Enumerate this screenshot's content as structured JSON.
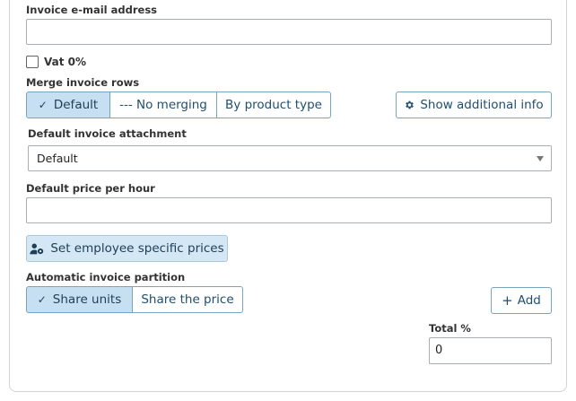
{
  "invoice_email": {
    "label": "Invoice e-mail address",
    "value": ""
  },
  "vat": {
    "label": "Vat 0%",
    "checked": false
  },
  "merge_rows": {
    "label": "Merge invoice rows",
    "options": [
      {
        "label": "Default",
        "active": true
      },
      {
        "label": "--- No merging",
        "active": false
      },
      {
        "label": "By product type",
        "active": false
      }
    ],
    "check_glyph": "✓"
  },
  "show_additional_info": {
    "label": "Show additional info",
    "icon": "gear-icon"
  },
  "attachment": {
    "label": "Default invoice attachment",
    "selected": "Default"
  },
  "price_per_hour": {
    "label": "Default price per hour",
    "value": ""
  },
  "employee_prices": {
    "label": "Set employee specific prices",
    "icon": "user-gear-icon"
  },
  "partition": {
    "label": "Automatic invoice partition",
    "options": [
      {
        "label": "Share units",
        "active": true
      },
      {
        "label": "Share the price",
        "active": false
      }
    ],
    "check_glyph": "✓"
  },
  "add_button": {
    "label": "Add",
    "glyph": "+"
  },
  "total": {
    "label": "Total %",
    "value": "0"
  },
  "colors": {
    "accent": "#1f4e6e",
    "active_bg": "#c6e0f2",
    "border": "#7aa3bd"
  }
}
